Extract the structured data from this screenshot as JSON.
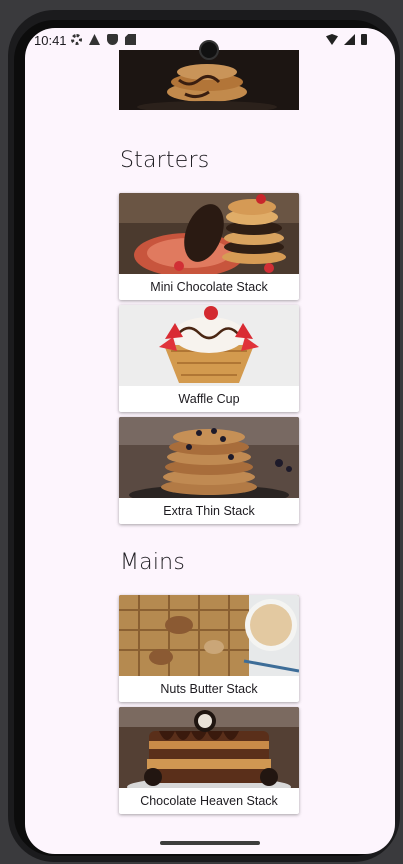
{
  "status": {
    "time": "10:41"
  },
  "sections": [
    {
      "title": "Starters"
    },
    {
      "title": "Mains"
    }
  ],
  "cards": [
    {
      "label": "Mini Chocolate Stack"
    },
    {
      "label": "Waffle Cup"
    },
    {
      "label": "Extra Thin Stack"
    },
    {
      "label": "Nuts Butter Stack"
    },
    {
      "label": "Chocolate Heaven Stack"
    }
  ],
  "colors": {
    "background": "#fdf5fd",
    "card": "#ffffff",
    "text": "#1d1b20"
  }
}
